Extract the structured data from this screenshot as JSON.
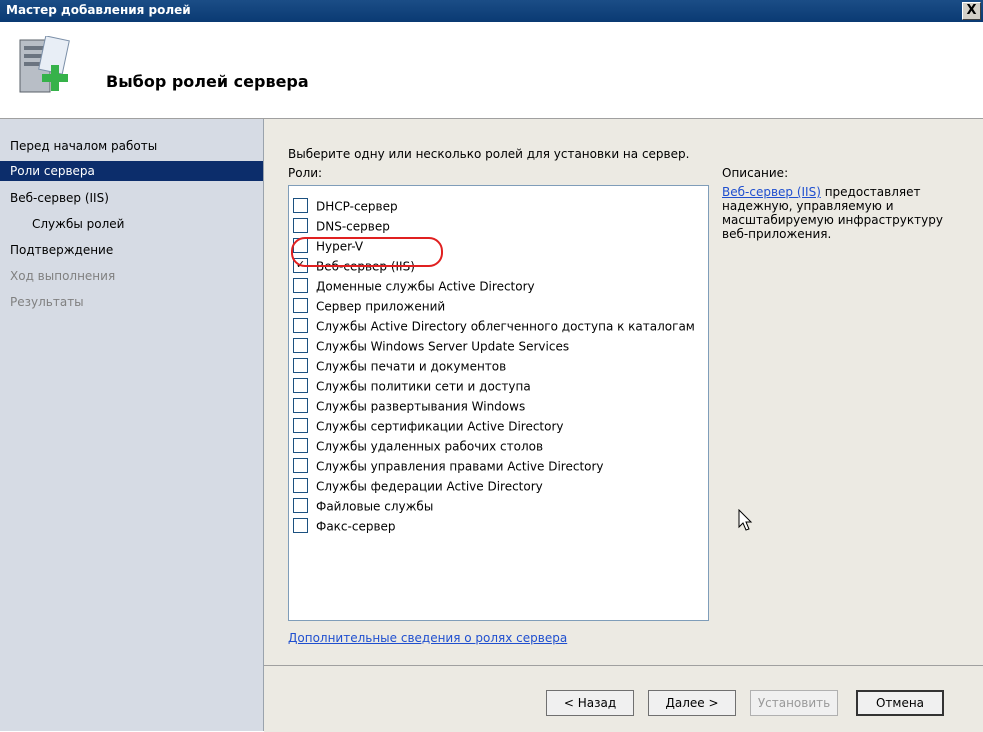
{
  "window": {
    "title": "Мастер добавления ролей",
    "close_glyph": "X"
  },
  "header": {
    "title": "Выбор ролей сервера",
    "icon": "server-add-icon"
  },
  "nav": {
    "items": [
      {
        "label": "Перед началом работы",
        "state": "normal"
      },
      {
        "label": "Роли сервера",
        "state": "active"
      },
      {
        "label": "Веб-сервер (IIS)",
        "state": "normal"
      },
      {
        "label": "Службы ролей",
        "state": "normal"
      },
      {
        "label": "Подтверждение",
        "state": "normal"
      },
      {
        "label": "Ход выполнения",
        "state": "disabled"
      },
      {
        "label": "Результаты",
        "state": "disabled"
      }
    ]
  },
  "main": {
    "instruction": "Выберите одну или несколько ролей для установки на сервер.",
    "roles_label": "Роли:",
    "description_label": "Описание:",
    "roles": [
      {
        "label": "DHCP-сервер",
        "checked": false
      },
      {
        "label": "DNS-сервер",
        "checked": false
      },
      {
        "label": "Hyper-V",
        "checked": false
      },
      {
        "label": "Веб-сервер (IIS)",
        "checked": true
      },
      {
        "label": "Доменные службы Active Directory",
        "checked": false
      },
      {
        "label": "Сервер приложений",
        "checked": false
      },
      {
        "label": "Службы Active Directory облегченного доступа к каталогам",
        "checked": false
      },
      {
        "label": "Службы Windows Server Update Services",
        "checked": false
      },
      {
        "label": "Службы печати и документов",
        "checked": false
      },
      {
        "label": "Службы политики сети и доступа",
        "checked": false
      },
      {
        "label": "Службы развертывания Windows",
        "checked": false
      },
      {
        "label": "Службы сертификации Active Directory",
        "checked": false
      },
      {
        "label": "Службы удаленных рабочих столов",
        "checked": false
      },
      {
        "label": "Службы управления правами Active Directory",
        "checked": false
      },
      {
        "label": "Службы федерации Active Directory",
        "checked": false
      },
      {
        "label": "Файловые службы",
        "checked": false
      },
      {
        "label": "Факс-сервер",
        "checked": false
      }
    ],
    "description": {
      "link": "Веб-сервер (IIS)",
      "text": " предоставляет надежную, управляемую и масштабируемую инфраструктуру веб-приложения."
    },
    "more_info_link": "Дополнительные сведения о ролях сервера",
    "highlight_color": "#e02020"
  },
  "footer": {
    "back": "< Назад",
    "next": "Далее >",
    "install": "Установить",
    "cancel": "Отмена"
  }
}
